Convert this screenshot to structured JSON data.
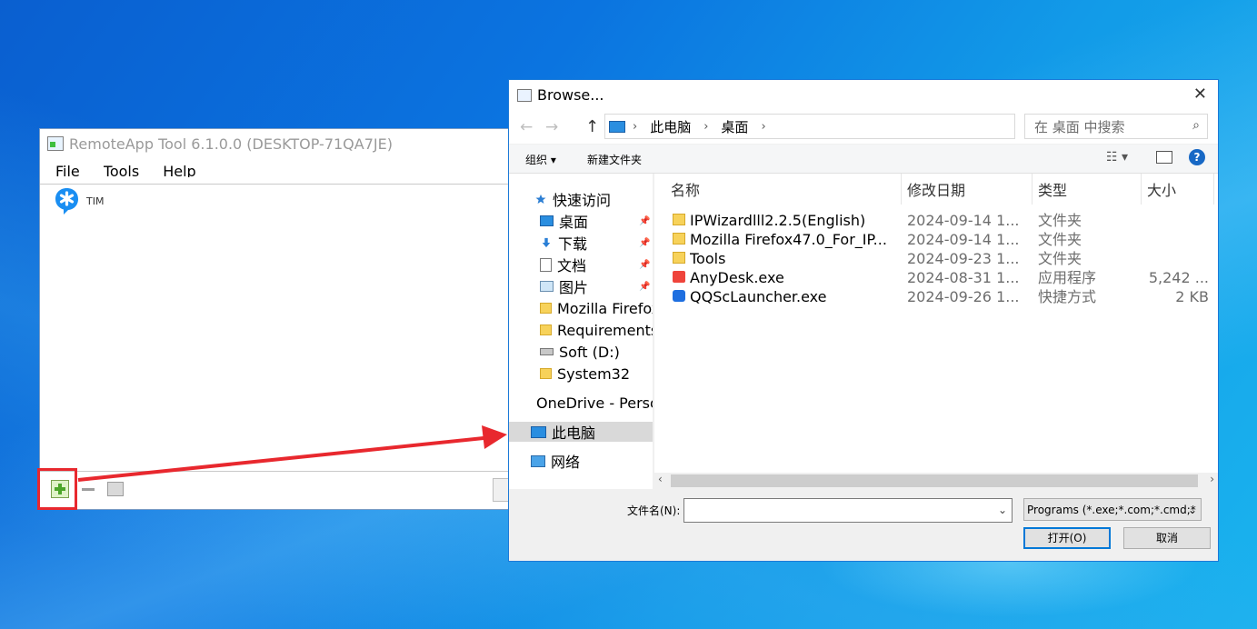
{
  "remoteapp": {
    "title": "RemoteApp Tool 6.1.0.0 (DESKTOP-71QA7JE)",
    "menu": [
      "File",
      "Tools",
      "Help"
    ],
    "apps": [
      {
        "name": "TIM",
        "icon": "tim-icon"
      }
    ]
  },
  "dialog": {
    "title": "Browse...",
    "close_glyph": "✕",
    "back_glyph": "←",
    "forward_glyph": "→",
    "up_glyph": "↑",
    "breadcrumb": [
      "此电脑",
      "桌面"
    ],
    "breadcrumb_sep": "›",
    "dropdown_glyph": "⌄",
    "refresh_glyph": "↻",
    "search_placeholder": "在 桌面 中搜索",
    "search_glyph": "⌕",
    "organize": "组织 ▾",
    "new_folder": "新建文件夹",
    "view_glyph": "☷ ▾",
    "help_glyph": "?",
    "sort_glyph": "˄",
    "pin_glyph": "📌",
    "scroll_left": "‹",
    "scroll_right": "›",
    "nav": [
      {
        "label": "快速访问",
        "icon": "star-icon",
        "pinned": false
      },
      {
        "label": "桌面",
        "icon": "desktop-icon",
        "pinned": true
      },
      {
        "label": "下载",
        "icon": "download-icon",
        "pinned": true
      },
      {
        "label": "文档",
        "icon": "document-icon",
        "pinned": true
      },
      {
        "label": "图片",
        "icon": "picture-icon",
        "pinned": true
      },
      {
        "label": "Mozilla Firefox",
        "icon": "folder-icon",
        "pinned": false
      },
      {
        "label": "Requirements",
        "icon": "folder-icon",
        "pinned": false
      },
      {
        "label": "Soft (D:)",
        "icon": "drive-icon",
        "pinned": false
      },
      {
        "label": "System32",
        "icon": "folder-icon",
        "pinned": false
      },
      {
        "label": "OneDrive - Personal",
        "icon": "cloud-icon",
        "pinned": false
      },
      {
        "label": "此电脑",
        "icon": "computer-icon",
        "pinned": false,
        "selected": true
      },
      {
        "label": "网络",
        "icon": "network-icon",
        "pinned": false
      }
    ],
    "columns": [
      "名称",
      "修改日期",
      "类型",
      "大小"
    ],
    "files": [
      {
        "name": "IPWizardlll2.2.5(English)",
        "date": "2024-09-14 1...",
        "type": "文件夹",
        "size": "",
        "icon": "folder-icon"
      },
      {
        "name": "Mozilla Firefox47.0_For_IP...",
        "date": "2024-09-14 1...",
        "type": "文件夹",
        "size": "",
        "icon": "folder-icon"
      },
      {
        "name": "Tools",
        "date": "2024-09-23 1...",
        "type": "文件夹",
        "size": "",
        "icon": "folder-icon"
      },
      {
        "name": "AnyDesk.exe",
        "date": "2024-08-31 1...",
        "type": "应用程序",
        "size": "5,242 ...",
        "icon": "anydesk-icon"
      },
      {
        "name": "QQScLauncher.exe",
        "date": "2024-09-26 1...",
        "type": "快捷方式",
        "size": "2 KB",
        "icon": "qq-icon"
      }
    ],
    "filename_label": "文件名(N):",
    "filename_value": "",
    "filter_value": "Programs (*.exe;*.com;*.cmd;*",
    "open_label": "打开(O)",
    "cancel_label": "取消"
  },
  "colors": {
    "highlight": "#e8282e",
    "accent": "#0078d7"
  }
}
